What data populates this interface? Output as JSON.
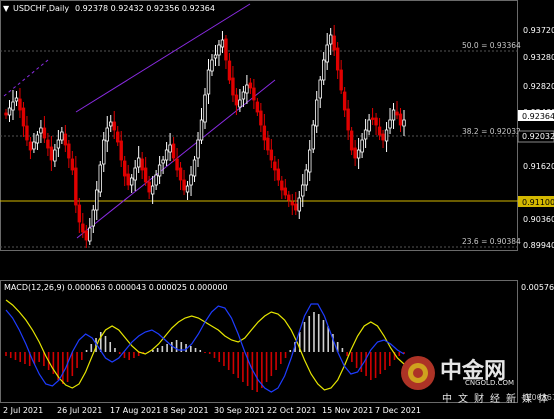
{
  "header": {
    "symbol_label": "USDCHF,Daily",
    "ohlc": "0.92378 0.92432 0.92356 0.92364"
  },
  "macd_header": {
    "label": "MACD(12,26,9) 0.000063 0.000043 0.000025 0.000000"
  },
  "price_axis": {
    "ticks": [
      "0.93720",
      "0.93280",
      "0.92820",
      "0.92460",
      "0.92040",
      "0.91620",
      "0.90360",
      "0.89940"
    ],
    "current_price": "0.92364",
    "hline_price": "0.91100",
    "fibo_price": "0.92032"
  },
  "macd_axis": {
    "top": "0.005764",
    "bottom": "-0.003674"
  },
  "time_axis": {
    "labels": [
      "2 Jul 2021",
      "26 Jul 2021",
      "17 Aug 2021",
      "8 Sep 2021",
      "30 Sep 2021",
      "22 Oct 2021",
      "15 Nov 2021",
      "7 Dec 2021"
    ]
  },
  "fibo": {
    "level_50": "50.0 = 0.93364",
    "level_38": "38.2 = 0.92032",
    "level_23": "23.6 = 0.90384"
  },
  "watermark": {
    "brand": "中金网",
    "domain": "CNGOLD.COM",
    "tagline": "中文财经新媒体"
  },
  "colors": {
    "background": "#000000",
    "bull_candle": "#ffffff",
    "bear_candle": "#e00000",
    "channel": "#8a2be2",
    "support_line": "#d4b800",
    "macd_signal": "#e6e600",
    "macd_main": "#1e3cff",
    "hist_up": "#d0d0d0",
    "hist_down": "#d00000"
  },
  "chart_data": {
    "type": "candlestick",
    "series": [
      {
        "name": "USDCHF,Daily",
        "description": "daily candles",
        "points_note": "approximate shape"
      }
    ],
    "price_range": [
      0.8994,
      0.9395
    ],
    "macd_range": [
      -0.003674,
      0.005764
    ],
    "key_levels": {
      "horizontal": 0.911,
      "fibo_50": 0.93364,
      "fibo_38_2": 0.92032,
      "fibo_23_6": 0.90384
    }
  }
}
